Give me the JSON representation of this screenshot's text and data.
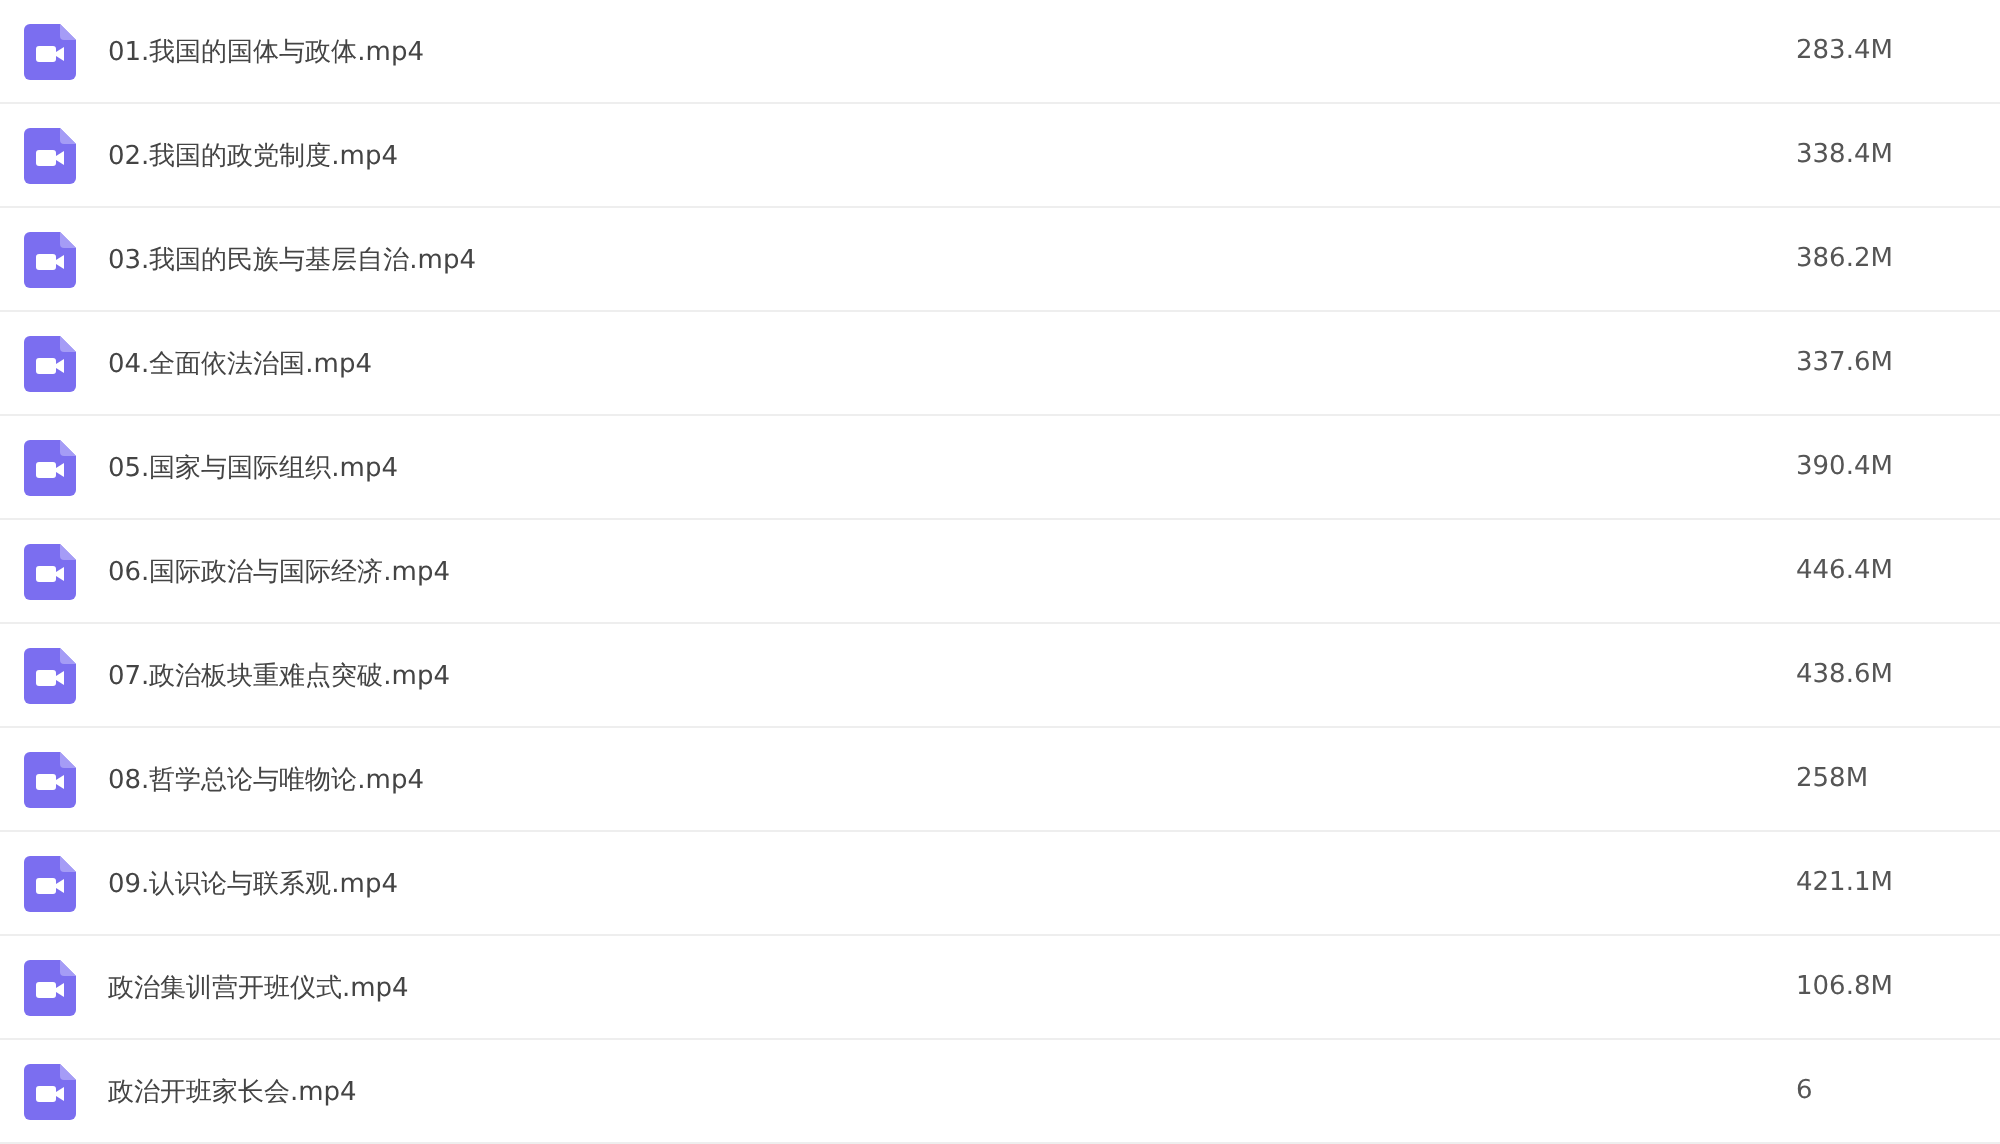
{
  "files": [
    {
      "name": "01.我国的国体与政体.mp4",
      "size": "283.4M"
    },
    {
      "name": "02.我国的政党制度.mp4",
      "size": "338.4M"
    },
    {
      "name": "03.我国的民族与基层自治.mp4",
      "size": "386.2M"
    },
    {
      "name": "04.全面依法治国.mp4",
      "size": "337.6M"
    },
    {
      "name": "05.国家与国际组织.mp4",
      "size": "390.4M"
    },
    {
      "name": "06.国际政治与国际经济.mp4",
      "size": "446.4M"
    },
    {
      "name": "07.政治板块重难点突破.mp4",
      "size": "438.6M"
    },
    {
      "name": "08.哲学总论与唯物论.mp4",
      "size": "258M"
    },
    {
      "name": "09.认识论与联系观.mp4",
      "size": "421.1M"
    },
    {
      "name": "政治集训营开班仪式.mp4",
      "size": "106.8M"
    },
    {
      "name": "政治开班家长会.mp4",
      "size": "6"
    }
  ]
}
